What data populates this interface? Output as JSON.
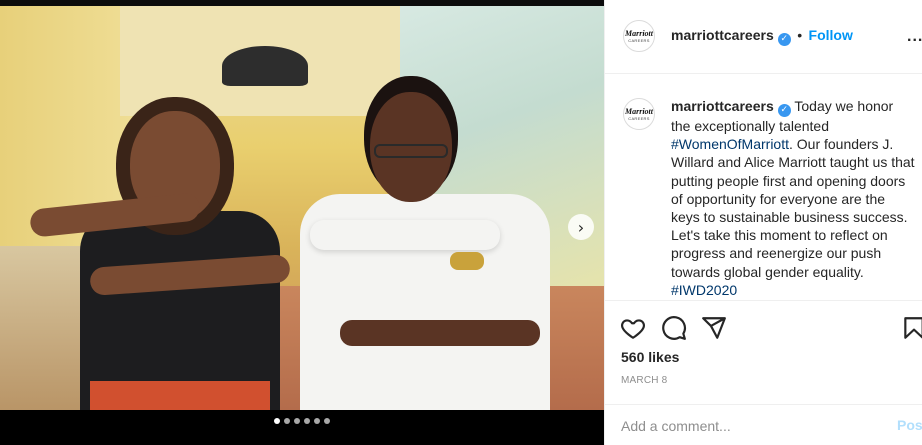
{
  "post": {
    "media": {
      "carousel": {
        "total_slides": 6,
        "active_index": 0
      },
      "next_icon": "chevron-right-icon"
    },
    "header": {
      "avatar": {
        "brand": "Marriott",
        "sub": "CAREERS"
      },
      "username": "marriottcareers",
      "verified_icon": "verified-badge-icon",
      "separator": "•",
      "follow_label": "Follow",
      "more_icon": "ellipsis-icon",
      "more_label": "..."
    },
    "caption": {
      "username": "marriottcareers",
      "text_before": "Today we honor the exceptionally talented ",
      "hashtag1": "#WomenOfMarriott",
      "text_middle": ". Our founders J. Willard and Alice Marriott taught us that putting people first and opening doors of opportunity for everyone are the keys to sustainable business success. Let's take this moment to reflect on progress and reenergize our push towards global gender equality. ",
      "hashtag2": "#IWD2020"
    },
    "actions": {
      "like_icon": "heart-icon",
      "comment_icon": "comment-bubble-icon",
      "share_icon": "paper-plane-icon",
      "save_icon": "bookmark-icon"
    },
    "likes": "560 likes",
    "date": "MARCH 8",
    "comment": {
      "placeholder": "Add a comment...",
      "post_label": "Post"
    },
    "colors": {
      "accent": "#0095f6",
      "verified": "#3897f0",
      "hashtag": "#00376b",
      "post_disabled": "#b2dffc"
    }
  }
}
